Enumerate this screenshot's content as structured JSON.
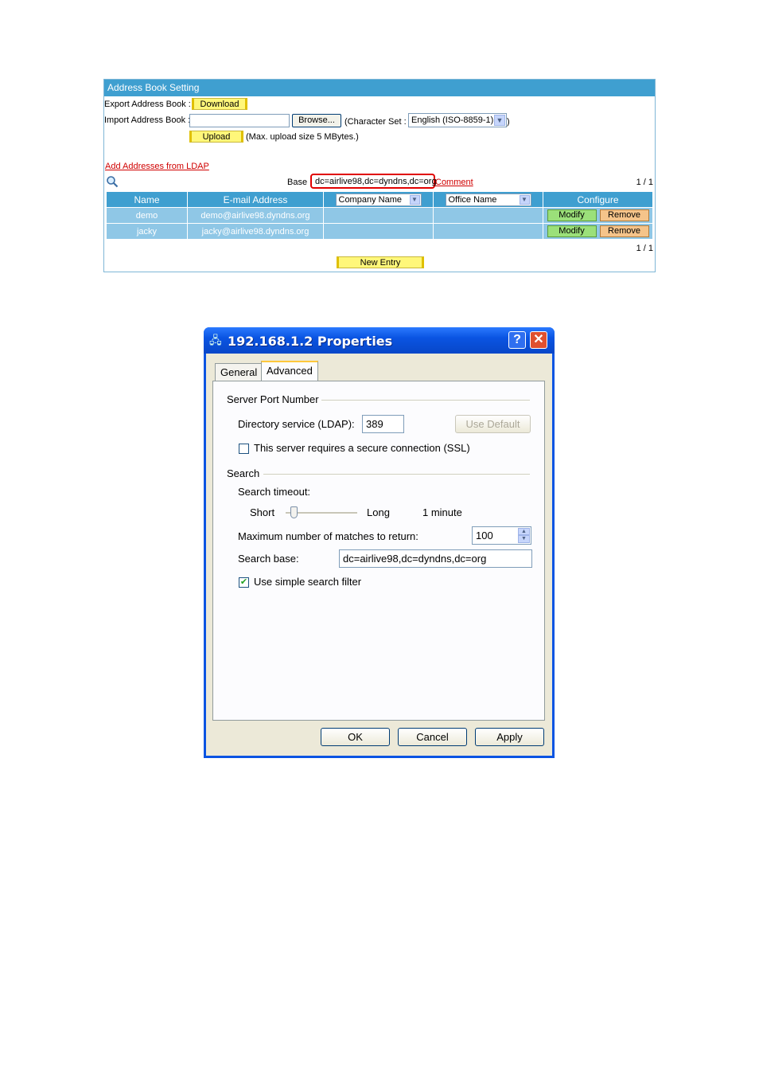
{
  "address_book": {
    "title": "Address Book Setting",
    "export_label": "Export Address Book :",
    "download_label": "Download",
    "import_label": "Import Address Book :",
    "import_value": "",
    "browse_label": "Browse...",
    "charset_prefix": "(Character Set :",
    "charset_value": "English (ISO-8859-1)",
    "charset_suffix": ")",
    "upload_label": "Upload",
    "upload_note": "(Max. upload size 5 MBytes.)",
    "ldap_link": "Add Addresses from LDAP",
    "base_label": "Base",
    "base_value": "dc=airlive98,dc=dyndns,dc=org",
    "comment_link": "Comment",
    "page_top": "1 / 1",
    "page_bottom": "1 / 1",
    "columns": {
      "name": "Name",
      "email": "E-mail Address",
      "company": "Company Name",
      "office": "Office Name",
      "configure": "Configure"
    },
    "rows": [
      {
        "name": "demo",
        "email": "demo@airlive98.dyndns.org",
        "modify": "Modify",
        "remove": "Remove"
      },
      {
        "name": "jacky",
        "email": "jacky@airlive98.dyndns.org",
        "modify": "Modify",
        "remove": "Remove"
      }
    ],
    "new_entry_label": "New Entry",
    "highlight_color": "#e00000"
  },
  "dialog": {
    "title": "192.168.1.2 Properties",
    "help_button": "?",
    "close_button": "✕",
    "tabs": [
      "General",
      "Advanced"
    ],
    "active_tab": "Advanced",
    "server_port_group": "Server Port Number",
    "ldap_label": "Directory service (LDAP):",
    "ldap_port": "389",
    "use_default_label": "Use Default",
    "ssl_label": "This server requires a secure connection (SSL)",
    "ssl_checked": false,
    "search_group": "Search",
    "timeout_label": "Search timeout:",
    "short_label": "Short",
    "long_label": "Long",
    "timeout_value": "1 minute",
    "timeout_slider_level": 0.08,
    "max_matches_label": "Maximum number of matches to return:",
    "max_matches_value": "100",
    "search_base_label": "Search base:",
    "search_base_value": "dc=airlive98,dc=dyndns,dc=org",
    "simple_filter_label": "Use simple search filter",
    "simple_filter_checked": true,
    "ok_label": "OK",
    "cancel_label": "Cancel",
    "apply_label": "Apply"
  }
}
